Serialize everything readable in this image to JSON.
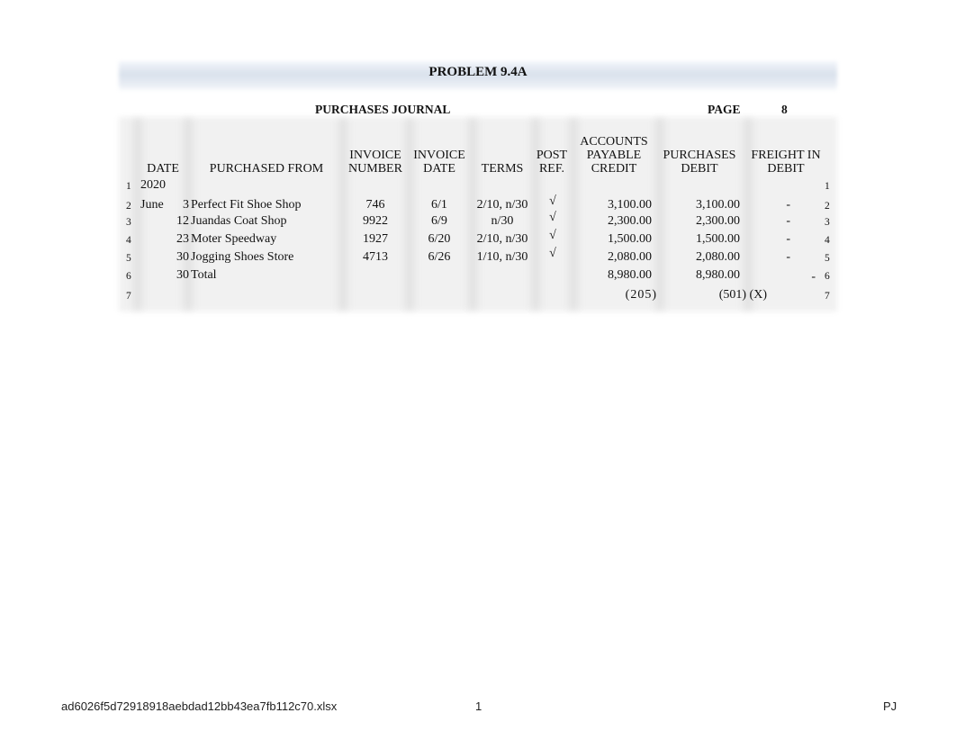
{
  "problem_title": "PROBLEM 9.4A",
  "journal": {
    "title": "PURCHASES JOURNAL",
    "page_label": "PAGE",
    "page_number": "8"
  },
  "headers": {
    "date": "DATE",
    "purchased_from": "PURCHASED FROM",
    "invoice_number": [
      "INVOICE",
      "NUMBER"
    ],
    "invoice_date": [
      "INVOICE",
      "DATE"
    ],
    "terms": "TERMS",
    "post_ref": [
      "POST",
      "REF."
    ],
    "ap_credit": [
      "ACCOUNTS",
      "PAYABLE",
      "CREDIT"
    ],
    "purchases_debit": [
      "PURCHASES",
      "DEBIT"
    ],
    "freight_debit": [
      "FREIGHT IN",
      "DEBIT"
    ]
  },
  "rows": [
    {
      "n": "1",
      "month": "2020",
      "day": "",
      "from": "",
      "inv_no": "",
      "inv_date": "",
      "terms": "",
      "post": "",
      "ap": "",
      "purch": "",
      "freight": ""
    },
    {
      "n": "2",
      "month": "June",
      "day": "3",
      "from": "Perfect Fit Shoe Shop",
      "inv_no": "746",
      "inv_date": "6/1",
      "terms": "2/10, n/30",
      "post": "√",
      "ap": "3,100.00",
      "purch": "3,100.00",
      "freight": "-"
    },
    {
      "n": "3",
      "month": "",
      "day": "12",
      "from": "Juandas Coat Shop",
      "inv_no": "9922",
      "inv_date": "6/9",
      "terms": "n/30",
      "post": "√",
      "ap": "2,300.00",
      "purch": "2,300.00",
      "freight": "-"
    },
    {
      "n": "4",
      "month": "",
      "day": "23",
      "from": "Moter Speedway",
      "inv_no": "1927",
      "inv_date": "6/20",
      "terms": "2/10, n/30",
      "post": "√",
      "ap": "1,500.00",
      "purch": "1,500.00",
      "freight": "-"
    },
    {
      "n": "5",
      "month": "",
      "day": "30",
      "from": "Jogging Shoes Store",
      "inv_no": "4713",
      "inv_date": "6/26",
      "terms": "1/10, n/30",
      "post": "√",
      "ap": "2,080.00",
      "purch": "2,080.00",
      "freight": "-"
    },
    {
      "n": "6",
      "month": "",
      "day": "30",
      "from": "Total",
      "inv_no": "",
      "inv_date": "",
      "terms": "",
      "post": "",
      "ap": "8,980.00",
      "purch": "8,980.00",
      "freight": "-"
    },
    {
      "n": "7",
      "month": "",
      "day": "",
      "from": "",
      "inv_no": "",
      "inv_date": "",
      "terms": "",
      "post": "",
      "ap": "(205)",
      "purch": "(501) (X)",
      "freight": ""
    }
  ],
  "footer": {
    "filename": "ad6026f5d72918918aebdad12bb43ea7fb112c70.xlsx",
    "page": "1",
    "sheet": "PJ"
  }
}
